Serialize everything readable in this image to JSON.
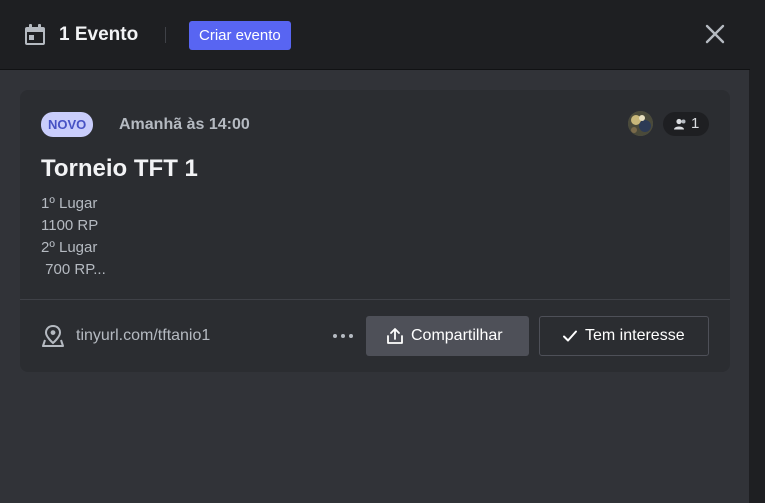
{
  "header": {
    "title": "1 Evento",
    "create_label": "Criar evento",
    "icons": {
      "calendar": "calendar-icon",
      "close": "close-icon"
    }
  },
  "event": {
    "badge": "NOVO",
    "time": "Amanhã às 14:00",
    "title": "Torneio TFT 1",
    "description": [
      "1º Lugar",
      "1100 RP",
      "2º Lugar",
      " 700 RP..."
    ],
    "interested_count": "1",
    "location": "tinyurl.com/tftanio1",
    "share_label": "Compartilhar",
    "interest_label": "Tem interesse"
  },
  "colors": {
    "accent": "#5865f2",
    "badge_bg": "#c9cdfb",
    "badge_text": "#4752c4",
    "card_bg": "#2b2d31",
    "modal_bg": "#313338",
    "header_bg": "#1e1f22"
  }
}
